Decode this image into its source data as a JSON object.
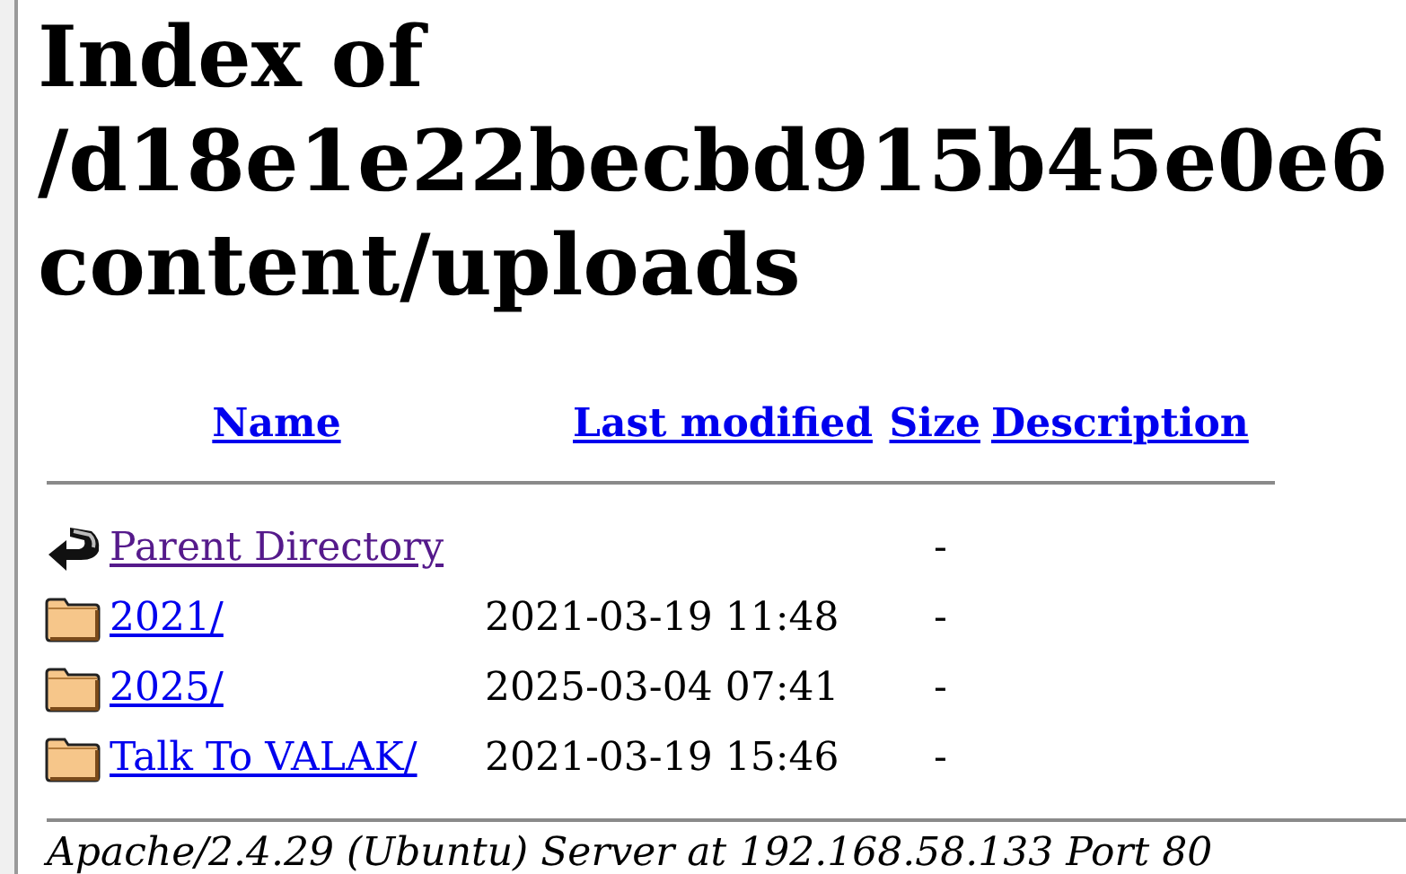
{
  "heading": {
    "line_1": "Index of",
    "line_2": "/d18e1e22becbd915b45e0e6",
    "line_3": "content/uploads"
  },
  "table": {
    "columns": [
      "Name",
      "Last modified",
      "Size",
      "Description"
    ],
    "rows": [
      {
        "kind": "parent",
        "name": "Parent Directory",
        "visited": true,
        "size": "-"
      },
      {
        "kind": "folder",
        "name": "2021/",
        "visited": false,
        "modified": "2021-03-19 11:48",
        "size": "-"
      },
      {
        "kind": "folder",
        "name": "2025/",
        "visited": false,
        "modified": "2025-03-04 07:41",
        "size": "-"
      },
      {
        "kind": "folder",
        "name": "Talk To VALAK/",
        "visited": false,
        "modified": "2021-03-19 15:46",
        "size": "-"
      }
    ]
  },
  "footer": "Apache/2.4.29 (Ubuntu) Server at 192.168.58.133 Port 80"
}
